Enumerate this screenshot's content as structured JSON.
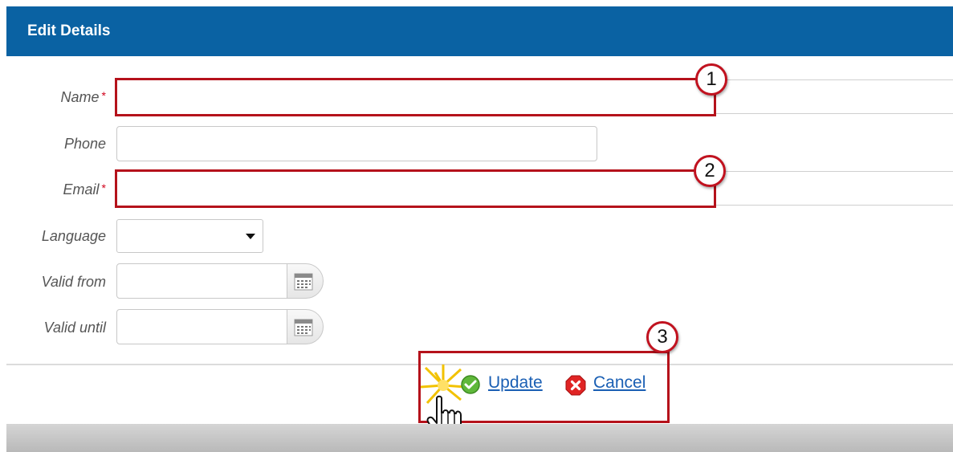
{
  "header": {
    "title": "Edit Details"
  },
  "form": {
    "name_label": "Name",
    "phone_label": "Phone",
    "email_label": "Email",
    "language_label": "Language",
    "valid_from_label": "Valid from",
    "valid_until_label": "Valid until",
    "required_mark": "*",
    "name_value": "",
    "phone_value": "",
    "email_value": "",
    "language_value": "",
    "valid_from_value": "",
    "valid_until_value": ""
  },
  "actions": {
    "update_label": "Update",
    "cancel_label": "Cancel"
  },
  "callouts": [
    "1",
    "2",
    "3"
  ],
  "colors": {
    "header": "#0a62a3",
    "highlight": "#b5121b",
    "link": "#1a5fb4"
  },
  "icons": [
    "calendar-icon",
    "check-icon",
    "cancel-icon",
    "hand-cursor-icon",
    "click-burst-icon",
    "dropdown-caret-icon"
  ]
}
